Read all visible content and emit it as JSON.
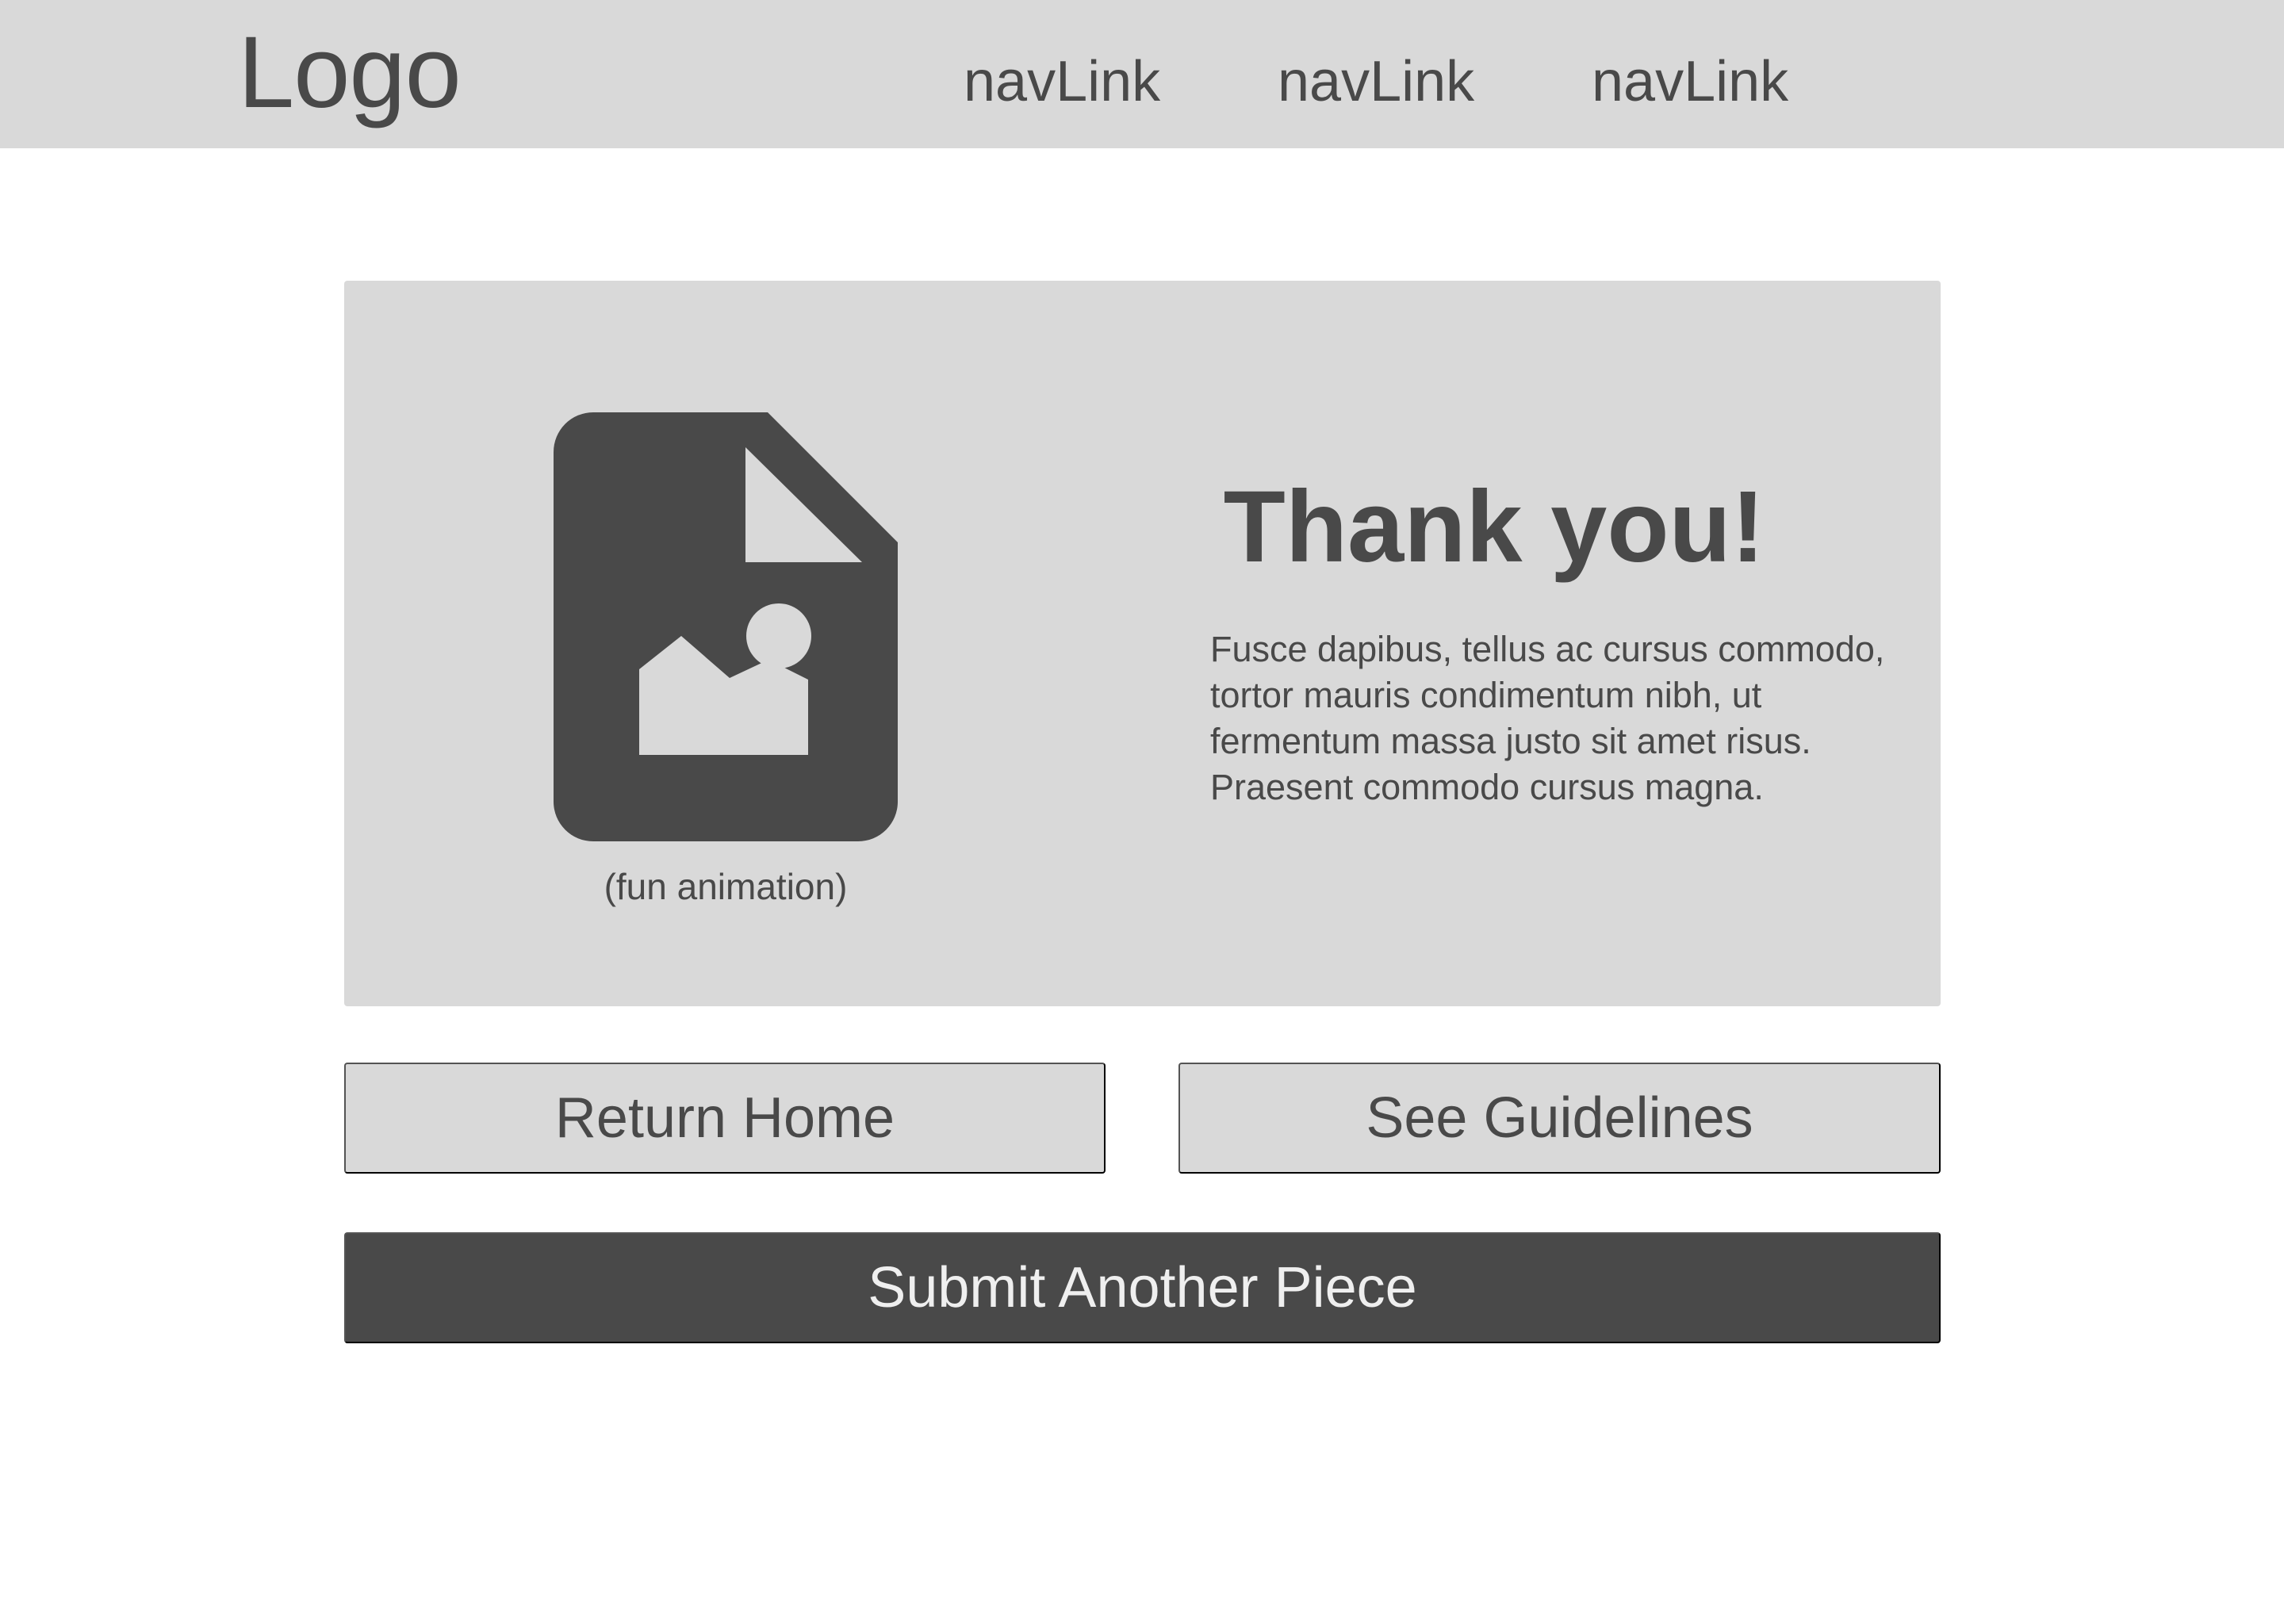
{
  "header": {
    "logo": "Logo",
    "nav_links": [
      "navLink",
      "navLink",
      "navLink"
    ]
  },
  "confirmation": {
    "icon": "image-file-icon",
    "caption": "(fun animation)",
    "title": "Thank you!",
    "message": "Fusce dapibus, tellus ac cursus commodo, tortor mauris condimentum nibh, ut fermentum massa justo sit amet risus. Praesent commodo cursus magna."
  },
  "actions": {
    "return_home": "Return Home",
    "see_guidelines": "See Guidelines",
    "submit_another": "Submit Another Piece"
  },
  "colors": {
    "panel": "#d9d9d9",
    "dark": "#494949",
    "background": "#ffffff"
  }
}
